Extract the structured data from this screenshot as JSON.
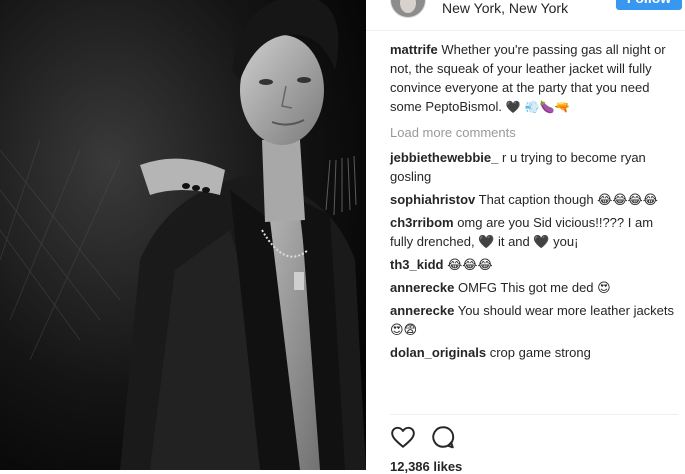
{
  "post": {
    "location": "New York, New York",
    "follow_label": "Follow",
    "caption": {
      "user": "mattrife",
      "text": "Whether you're passing gas all night or not, the squeak of your leather jacket will fully convince everyone at the party that you need some PeptoBismol.",
      "emoji": " 🖤 💨🍆🔫"
    },
    "load_more_label": "Load more comments",
    "comments": [
      {
        "user": "jebbiethewebbie_",
        "text": "r u trying to become ryan gosling"
      },
      {
        "user": "sophiahristov",
        "text": "That caption though 😂😂😂😂"
      },
      {
        "user": "ch3rribom",
        "text": "omg are you Sid vicious!!??? I am fully drenched, 🖤 it and 🖤 you¡"
      },
      {
        "user": "th3_kidd",
        "text": "😂😂😂"
      },
      {
        "user": "annerecke",
        "text": "OMFG This got me ded 😍"
      },
      {
        "user": "annerecke",
        "text": "You should wear more leather jackets 😍😨"
      },
      {
        "user": "dolan_originals",
        "text": "crop game strong"
      }
    ],
    "likes_label": "12,386 likes",
    "icons": {
      "like": "heart-icon",
      "comment": "comment-bubble-icon"
    }
  }
}
